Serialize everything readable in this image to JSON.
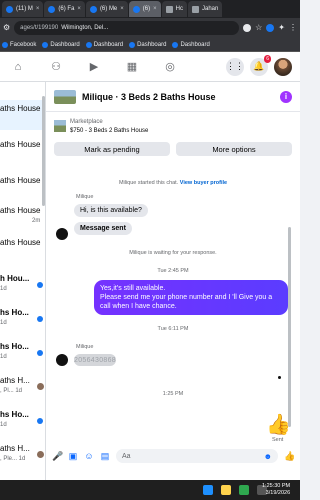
{
  "browser": {
    "tabs": [
      {
        "label": "(11) M",
        "active": false
      },
      {
        "label": "(6) Fa",
        "active": false
      },
      {
        "label": "(6) Me",
        "active": false
      },
      {
        "label": "(6)",
        "active": true
      },
      {
        "label": "Hc",
        "active": false
      },
      {
        "label": "Jahan",
        "active": false
      }
    ],
    "tab_close": "×",
    "url_text": "ages/t/199190",
    "url_context": "Wilmington, Del...",
    "bookmarks": [
      "Facebook",
      "Dashboard",
      "Dashboard",
      "Dashboard",
      "Dashboard"
    ]
  },
  "fbnav": {
    "notification_count": "6"
  },
  "chat_list": [
    {
      "name": "aths House",
      "sub": "",
      "bold": false,
      "dot": false,
      "mini": false
    },
    {
      "name": "aths House",
      "sub": "",
      "bold": false,
      "dot": false,
      "mini": false
    },
    {
      "name": "aths House",
      "sub": "",
      "bold": false,
      "dot": false,
      "mini": false
    },
    {
      "name": "aths House",
      "sub": "2m",
      "bold": false,
      "dot": false,
      "mini": false
    },
    {
      "name": "aths House",
      "sub": "",
      "bold": false,
      "dot": false,
      "mini": false
    },
    {
      "name": "h Hou...",
      "sub": "1d",
      "bold": true,
      "dot": true,
      "mini": false
    },
    {
      "name": "hs Ho...",
      "sub": "1d",
      "bold": true,
      "dot": true,
      "mini": false
    },
    {
      "name": "hs Ho...",
      "sub": "1d",
      "bold": true,
      "dot": true,
      "mini": false
    },
    {
      "name": "aths H...",
      "sub": ", Pl... 1d",
      "bold": false,
      "dot": false,
      "mini": true
    },
    {
      "name": "hs Ho...",
      "sub": "1d",
      "bold": true,
      "dot": true,
      "mini": false
    },
    {
      "name": "aths H...",
      "sub": ", Ple... 1d",
      "bold": false,
      "dot": false,
      "mini": true
    }
  ],
  "conversation": {
    "title": "Milique · 3 Beds 2 Baths House",
    "marketplace_label": "Marketplace",
    "listing": "$750 - 3 Beds 2 Baths House",
    "mark_pending": "Mark as pending",
    "more_options": "More options",
    "started_text": "Milique started this chat.",
    "view_profile": "View buyer profile",
    "sender_name": "Milique",
    "msg1": "Hi, is this available?",
    "msg2": "Message sent",
    "waiting": "Milique is waiting for your response.",
    "time1": "Tue 2:45 PM",
    "reply": "Yes,it's still available.\nPlease send me your phone number and I 'll Give you a call when I have chance.",
    "time2": "Tue 6:11 PM",
    "sender_name2": "Milique",
    "phone": "2056430868",
    "time3": "1:25 PM",
    "sent_label": "Sent",
    "composer_placeholder": "Aa"
  },
  "taskbar": {
    "time": "1:25:30 PM",
    "date": "3/19/2026"
  },
  "colors": {
    "accent": "#0866ff",
    "outgoing_bubble": "#6a34ff",
    "unread_dot": "#1877f2"
  }
}
